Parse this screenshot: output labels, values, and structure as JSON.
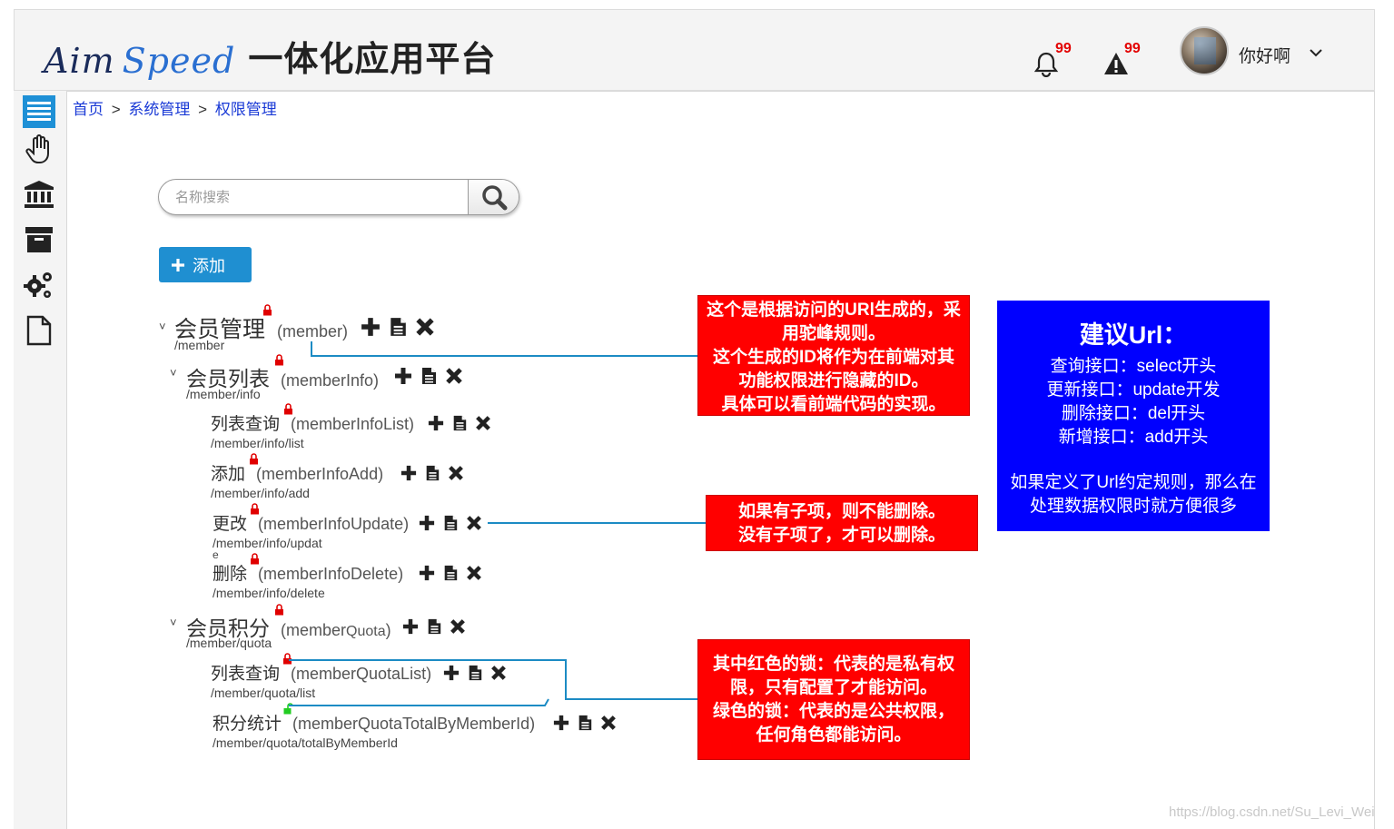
{
  "header": {
    "logo_en_a": "Aim",
    "logo_en_b": "Speed",
    "logo_cn": "一体化应用平台",
    "notifications_count": "99",
    "alerts_count": "99",
    "username": "你好啊"
  },
  "breadcrumb": {
    "home": "首页",
    "sep1": ">",
    "level1": "系统管理",
    "sep2": ">",
    "level2": "权限管理"
  },
  "search": {
    "placeholder": "名称搜索",
    "value": ""
  },
  "toolbar": {
    "add_label": "添加"
  },
  "tree": [
    {
      "name": "会员管理",
      "code": "(member)",
      "path": "/member",
      "caret": "˅",
      "lock": "red"
    },
    {
      "name": "会员列表",
      "code": "(memberInfo)",
      "path": "/member/info",
      "caret": "˅",
      "lock": "red"
    },
    {
      "name": "列表查询",
      "code": "(memberInfoList)",
      "path": "/member/info/list",
      "lock": "red"
    },
    {
      "name": "添加",
      "code": "(memberInfoAdd)",
      "path": "/member/info/add",
      "lock": "red"
    },
    {
      "name": "更改",
      "code": "(memberInfoUpdate)",
      "path": "/member/info/updat",
      "path_wrap": "e",
      "lock": "red"
    },
    {
      "name": "删除",
      "code": "(memberInfoDelete)",
      "path": "/member/info/delete",
      "lock": "red"
    },
    {
      "name": "会员积分",
      "code": "(memberQuota)",
      "code_a": "(member",
      "code_b": "Quota",
      "code_c": ")",
      "path": "/member/quota",
      "caret": "˅",
      "lock": "red"
    },
    {
      "name": "列表查询",
      "code": "(memberQuotaList)",
      "path": "/member/quota/list",
      "lock": "red"
    },
    {
      "name": "积分统计",
      "code": "(memberQuotaTotalByMemberId)",
      "path": "/member/quota/totalByMemberId",
      "lock": "green"
    }
  ],
  "callouts": {
    "id_rule": [
      "这个是根据访问的URl生成的，采",
      "用驼峰规则。",
      "这个生成的ID将作为在前端对其",
      "功能权限进行隐藏的ID。",
      "具体可以看前端代码的实现。"
    ],
    "delete_rule": [
      "如果有子项，则不能删除。",
      "没有子项了，才可以删除。"
    ],
    "lock_rule": [
      "其中红色的锁：代表的是私有权",
      "限，只有配置了才能访问。",
      "绿色的锁：代表的是公共权限，",
      "任何角色都能访问。"
    ],
    "url_suggest": {
      "title": "建议Url：",
      "lines": [
        "查询接口：select开头",
        "更新接口：update开发",
        "删除接口：del开头",
        "新增接口：add开头"
      ],
      "note": [
        "如果定义了Url约定规则，那么在",
        "处理数据权限时就方便很多"
      ]
    }
  },
  "watermark": "https://blog.csdn.net/Su_Levi_Wei",
  "colors": {
    "accent": "#1f8fd1",
    "callout_red": "#ff0000",
    "callout_blue": "#0000ff",
    "lock_private": "#e00000",
    "lock_public": "#22cc22",
    "connector": "#1c8bc4"
  },
  "icons": {
    "bell": "bell-icon",
    "alert": "warning-icon",
    "menu": "menu-icon",
    "hand": "hand-icon",
    "bank": "bank-icon",
    "archive": "archive-icon",
    "gears": "gears-icon",
    "file": "file-icon",
    "search": "search-icon",
    "add": "plus-icon",
    "edit": "document-icon",
    "delete": "close-icon"
  }
}
